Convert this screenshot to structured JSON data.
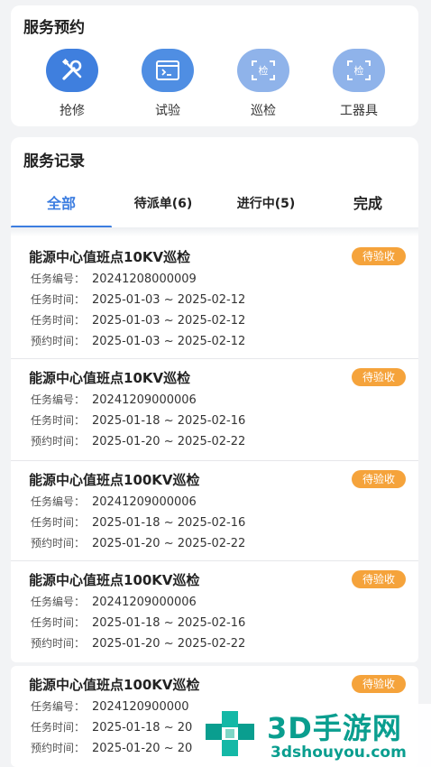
{
  "booking": {
    "title": "服务预约",
    "services": [
      {
        "label": "抢修",
        "icon": "wrench-screwdriver-icon",
        "color": "#3f7fde"
      },
      {
        "label": "试验",
        "icon": "terminal-window-icon",
        "color": "#4f8ee3"
      },
      {
        "label": "巡检",
        "icon": "inspect-scan-icon",
        "color": "#8fb3ea"
      },
      {
        "label": "工器具",
        "icon": "tool-scan-icon",
        "color": "#8fb3ea"
      }
    ]
  },
  "records": {
    "title": "服务记录",
    "tabs": [
      {
        "label": "全部",
        "active": true
      },
      {
        "label": "待派单(6)",
        "active": false
      },
      {
        "label": "进行中(5)",
        "active": false
      },
      {
        "label": "完成",
        "active": false
      }
    ],
    "tasks": [
      {
        "title": "能源中心值班点10KV巡检",
        "status": "待验收",
        "rows": [
          {
            "key": "任务编号：",
            "value": "20241208000009"
          },
          {
            "key": "任务时间：",
            "value": "2025-01-03 ~ 2025-02-12"
          },
          {
            "key": "任务时间：",
            "value": "2025-01-03 ~ 2025-02-12"
          },
          {
            "key": "预约时间：",
            "value": "2025-01-03 ~ 2025-02-12"
          }
        ]
      },
      {
        "title": "能源中心值班点10KV巡检",
        "status": "待验收",
        "rows": [
          {
            "key": "任务编号：",
            "value": "20241209000006"
          },
          {
            "key": "任务时间：",
            "value": "2025-01-18 ~ 2025-02-16"
          },
          {
            "key": "预约时间：",
            "value": "2025-01-20 ~ 2025-02-22"
          }
        ]
      },
      {
        "title": "能源中心值班点100KV巡检",
        "status": "待验收",
        "rows": [
          {
            "key": "任务编号：",
            "value": "20241209000006"
          },
          {
            "key": "任务时间：",
            "value": "2025-01-18 ~ 2025-02-16"
          },
          {
            "key": "预约时间：",
            "value": "2025-01-20 ~ 2025-02-22"
          }
        ]
      },
      {
        "title": "能源中心值班点100KV巡检",
        "status": "待验收",
        "rows": [
          {
            "key": "任务编号：",
            "value": "20241209000006"
          },
          {
            "key": "任务时间：",
            "value": "2025-01-18 ~ 2025-02-16"
          },
          {
            "key": "预约时间：",
            "value": "2025-01-20 ~ 2025-02-22"
          }
        ]
      },
      {
        "title": "能源中心值班点100KV巡检",
        "status": "待验收",
        "rows": [
          {
            "key": "任务编号：",
            "value": "2024120900000"
          },
          {
            "key": "任务时间：",
            "value": "2025-01-18 ~ 20"
          },
          {
            "key": "预约时间：",
            "value": "2025-01-20 ~ 20"
          }
        ]
      }
    ]
  },
  "watermark": {
    "brand": "3D手游网",
    "url": "3dshouyou.com",
    "color": "#0a9e8f"
  },
  "colors": {
    "accent": "#3c7de0",
    "badge": "#f5a33b",
    "background": "#f2f3f5"
  }
}
